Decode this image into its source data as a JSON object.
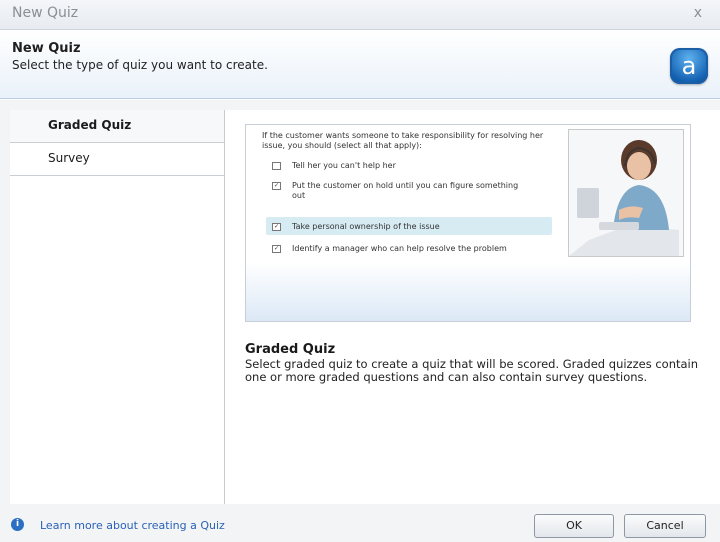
{
  "window": {
    "title": "New Quiz",
    "close_label": "x"
  },
  "header": {
    "title": "New Quiz",
    "subtitle": "Select the type of quiz you want to create.",
    "logo_letter": "a"
  },
  "sidebar": {
    "items": [
      {
        "label": "Graded Quiz",
        "selected": true
      },
      {
        "label": "Survey",
        "selected": false
      }
    ]
  },
  "preview": {
    "question": "If the customer wants someone to take responsibility for resolving her issue, you should (select all that apply):",
    "options": [
      {
        "text": "Tell her you can't help her",
        "checked": false
      },
      {
        "text": "Put the customer on hold until you can figure something out",
        "checked": true
      },
      {
        "text": "Take personal ownership of the issue",
        "checked": true
      },
      {
        "text": "Identify a manager who can help resolve the problem",
        "checked": true
      }
    ],
    "image_icon": "woman-with-headset-photo"
  },
  "description": {
    "title": "Graded Quiz",
    "text": "Select graded quiz to create a quiz that will be scored. Graded quizzes contain one or more graded questions and can also contain survey questions."
  },
  "footer": {
    "learn_more": "Learn more about creating a Quiz",
    "ok_label": "OK",
    "cancel_label": "Cancel"
  },
  "colors": {
    "link": "#2a62b7",
    "header_border": "#b9cfe6",
    "logo": "#1563b3"
  }
}
